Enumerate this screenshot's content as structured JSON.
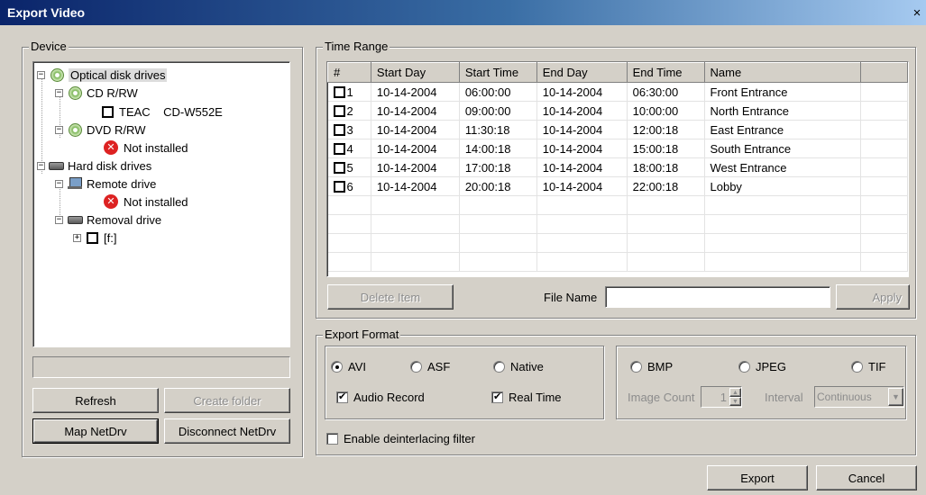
{
  "window": {
    "title": "Export Video",
    "close_glyph": "×"
  },
  "device": {
    "group_label": "Device",
    "tree": {
      "optical": "Optical disk drives",
      "cdrw": "CD R/RW",
      "teac": "TEAC    CD-W552E",
      "dvdrw": "DVD R/RW",
      "dvd_not_installed": "Not installed",
      "hdd": "Hard disk drives",
      "remote": "Remote drive",
      "remote_not_installed": "Not installed",
      "removal": "Removal drive",
      "f_drive": "[f:]"
    },
    "path_field": "",
    "buttons": {
      "refresh": "Refresh",
      "create_folder": "Create folder",
      "map_netdrv": "Map NetDrv",
      "disconnect_netdrv": "Disconnect NetDrv"
    }
  },
  "time_range": {
    "group_label": "Time Range",
    "columns": [
      "#",
      "Start Day",
      "Start Time",
      "End Day",
      "End Time",
      "Name"
    ],
    "rows": [
      {
        "num": "1",
        "start_day": "10-14-2004",
        "start_time": "06:00:00",
        "end_day": "10-14-2004",
        "end_time": "06:30:00",
        "name": "Front Entrance"
      },
      {
        "num": "2",
        "start_day": "10-14-2004",
        "start_time": "09:00:00",
        "end_day": "10-14-2004",
        "end_time": "10:00:00",
        "name": "North Entrance"
      },
      {
        "num": "3",
        "start_day": "10-14-2004",
        "start_time": "11:30:18",
        "end_day": "10-14-2004",
        "end_time": "12:00:18",
        "name": "East Entrance"
      },
      {
        "num": "4",
        "start_day": "10-14-2004",
        "start_time": "14:00:18",
        "end_day": "10-14-2004",
        "end_time": "15:00:18",
        "name": "South Entrance"
      },
      {
        "num": "5",
        "start_day": "10-14-2004",
        "start_time": "17:00:18",
        "end_day": "10-14-2004",
        "end_time": "18:00:18",
        "name": "West Entrance"
      },
      {
        "num": "6",
        "start_day": "10-14-2004",
        "start_time": "20:00:18",
        "end_day": "10-14-2004",
        "end_time": "22:00:18",
        "name": "Lobby"
      }
    ],
    "delete_item": "Delete Item",
    "file_name_label": "File Name",
    "file_name_value": "",
    "apply": "Apply"
  },
  "export_format": {
    "group_label": "Export Format",
    "video": {
      "avi": "AVI",
      "asf": "ASF",
      "native": "Native",
      "selected": "AVI"
    },
    "audio_record": "Audio Record",
    "real_time": "Real Time",
    "image": {
      "bmp": "BMP",
      "jpeg": "JPEG",
      "tif": "TIF"
    },
    "image_count_label": "Image Count",
    "image_count_value": "1",
    "interval_label": "Interval",
    "interval_value": "Continuous",
    "deinterlace": "Enable deinterlacing filter"
  },
  "footer": {
    "export": "Export",
    "cancel": "Cancel"
  }
}
